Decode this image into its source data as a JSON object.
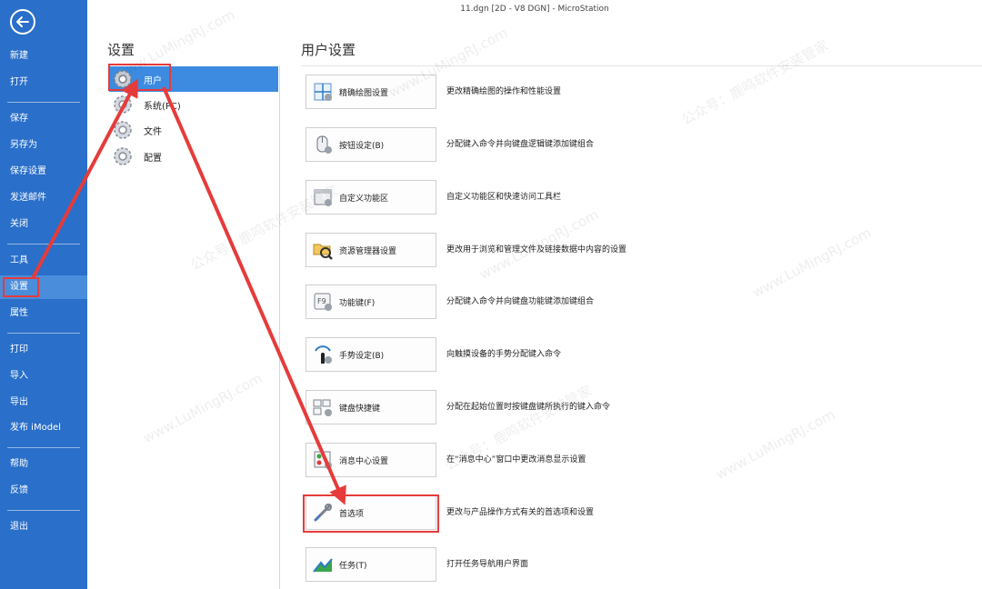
{
  "window": {
    "title": "11.dgn [2D - V8 DGN] - MicroStation"
  },
  "nav": {
    "items": [
      {
        "label": "新建"
      },
      {
        "label": "打开"
      },
      {
        "label": "保存"
      },
      {
        "label": "另存为"
      },
      {
        "label": "保存设置"
      },
      {
        "label": "发送邮件"
      },
      {
        "label": "关闭"
      },
      {
        "label": "工具"
      },
      {
        "label": "设置"
      },
      {
        "label": "属性"
      },
      {
        "label": "打印"
      },
      {
        "label": "导入"
      },
      {
        "label": "导出"
      },
      {
        "label": "发布 iModel"
      },
      {
        "label": "帮助"
      },
      {
        "label": "反馈"
      },
      {
        "label": "退出"
      }
    ],
    "active_label": "设置"
  },
  "settings": {
    "title": "设置",
    "categories": [
      {
        "label": "用户"
      },
      {
        "label": "系统(PC)"
      },
      {
        "label": "文件"
      },
      {
        "label": "配置"
      }
    ]
  },
  "user_settings": {
    "title": "用户设置",
    "rows": [
      {
        "label": "精确绘图设置",
        "desc": "更改精确绘图的操作和性能设置",
        "icon": "accudraw-icon"
      },
      {
        "label": "按钮设定(B)",
        "desc": "分配键入命令并向键盘逻辑键添加键组合",
        "icon": "mouse-icon"
      },
      {
        "label": "自定义功能区",
        "desc": "自定义功能区和快速访问工具栏",
        "icon": "ribbon-icon"
      },
      {
        "label": "资源管理器设置",
        "desc": "更改用于浏览和管理文件及链接数据中内容的设置",
        "icon": "explorer-icon"
      },
      {
        "label": "功能键(F)",
        "desc": "分配键入命令并向键盘功能键添加键组合",
        "icon": "function-key-icon"
      },
      {
        "label": "手势设定(B)",
        "desc": "向触摸设备的手势分配键入命令",
        "icon": "gesture-icon"
      },
      {
        "label": "键盘快捷键",
        "desc": "分配在起始位置时按键盘键所执行的键入命令",
        "icon": "keyboard-icon"
      },
      {
        "label": "消息中心设置",
        "desc": "在“消息中心”窗口中更改消息显示设置",
        "icon": "message-center-icon"
      },
      {
        "label": "首选项",
        "desc": "更改与产品操作方式有关的首选项和设置",
        "icon": "preferences-icon"
      },
      {
        "label": "任务(T)",
        "desc": "打开任务导航用户界面",
        "icon": "tasks-icon"
      }
    ]
  },
  "watermark": {
    "text": "公众号：鹿鸣软件安装管家",
    "site": "www.LuMingRJ.com"
  },
  "colors": {
    "nav_bg": "#2a6fc9",
    "selected_bg": "#3d8be0",
    "highlight": "#e63b3b"
  }
}
